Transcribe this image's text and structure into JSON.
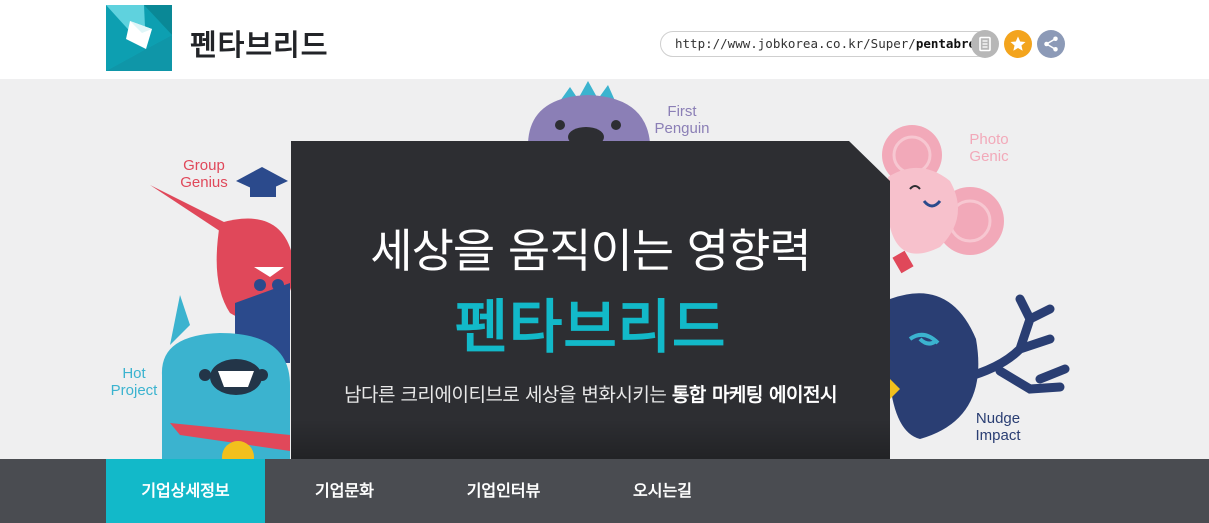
{
  "header": {
    "company_name": "펜타브리드",
    "url_prefix": "http://www.jobkorea.co.kr/Super/",
    "url_slug": "pentabreed/",
    "icons": {
      "copy": "copy-icon",
      "favorite": "star-icon",
      "share": "share-icon"
    }
  },
  "hero": {
    "tagline": "세상을 움직이는 영향력",
    "title": "펜타브리드",
    "description_prefix": "남다른 크리에이티브로 세상을 변화시키는 ",
    "description_bold": "통합 마케팅 에이전시",
    "characters": {
      "group_genius": "Group\nGenius",
      "first_penguin": "First\nPenguin",
      "photo_genic": "Photo\nGenic",
      "hot_project": "Hot\nProject",
      "nudge_impact": "Nudge\nImpact"
    }
  },
  "nav": {
    "tabs": [
      "기업상세정보",
      "기업문화",
      "기업인터뷰",
      "오시는길"
    ],
    "active_index": 0
  },
  "colors": {
    "accent": "#12b9c9",
    "panel": "#2d2e32",
    "nav_bg": "#4a4c51",
    "hero_bg": "#efeff0",
    "group_genius": "#e0485a",
    "first_penguin": "#8b7fb6",
    "photo_genic": "#f2a9b9",
    "hot_project": "#3bb3cf",
    "nudge_impact": "#2a3e73"
  }
}
